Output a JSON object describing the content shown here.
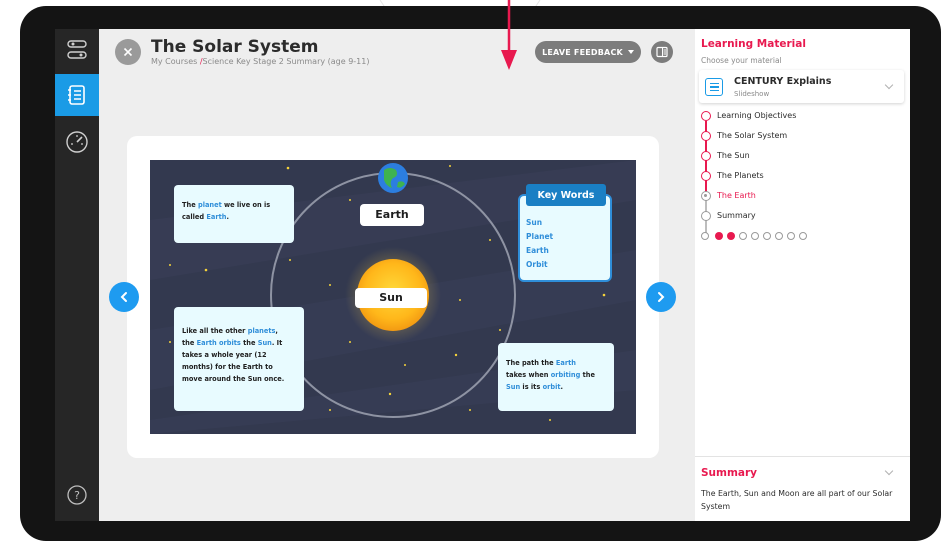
{
  "header": {
    "title": "The Solar System",
    "breadcrumb_course": "My Courses ",
    "breadcrumb_sep": "/",
    "breadcrumb_page": "Science Key Stage 2 Summary (age 9-11)",
    "feedback_label": "LEAVE FEEDBACK"
  },
  "nav": {
    "items": [
      {
        "icon": "path-icon"
      },
      {
        "icon": "notebook-icon",
        "active": true
      },
      {
        "icon": "dashboard-icon"
      },
      {
        "icon": "help-icon"
      }
    ],
    "help_label": "?"
  },
  "slide": {
    "bubble1": [
      "The ",
      "planet",
      " we live on is",
      "called ",
      "Earth",
      "."
    ],
    "bubble2_lines": [
      [
        "Like all the other ",
        "planets",
        ","
      ],
      [
        "the ",
        "Earth orbits",
        " the ",
        "Sun",
        ". It"
      ],
      [
        "takes a whole year (12"
      ],
      [
        "months) for the Earth to"
      ],
      [
        "move around the Sun once."
      ]
    ],
    "bubble3_lines": [
      [
        "The path the ",
        "Earth"
      ],
      [
        "takes when ",
        "orbiting",
        " the"
      ],
      [
        "Sun",
        " is its ",
        "orbit",
        "."
      ]
    ],
    "earth_label": "Earth",
    "sun_label": "Sun",
    "key_words_title": "Key Words",
    "key_words": [
      "Sun",
      "Planet",
      "Earth",
      "Orbit"
    ]
  },
  "panel": {
    "title": "Learning Material",
    "subtitle": "Choose your material",
    "material_name": "CENTURY Explains",
    "material_type": "Slideshow",
    "sections": [
      {
        "label": "Learning Objectives",
        "state": "done"
      },
      {
        "label": "The Solar System",
        "state": "done"
      },
      {
        "label": "The Sun",
        "state": "done"
      },
      {
        "label": "The Planets",
        "state": "done"
      },
      {
        "label": "The Earth",
        "state": "current"
      },
      {
        "label": "Summary",
        "state": "todo"
      }
    ],
    "page_dots": {
      "total": 8,
      "filled": 2
    },
    "summary_title": "Summary",
    "summary_text": "The Earth, Sun and Moon are all part of our Solar System"
  },
  "colors": {
    "accent_red": "#e8194f",
    "accent_blue": "#1a9be6",
    "nav_bg": "#262626",
    "slide_bg": "#33394f"
  }
}
